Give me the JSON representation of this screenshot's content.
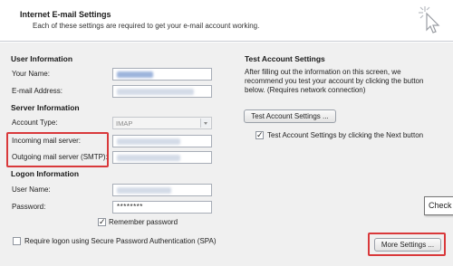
{
  "header": {
    "title": "Internet E-mail Settings",
    "subtitle": "Each of these settings are required to get your e-mail account working."
  },
  "icons": {
    "header_icon": "cursor-click-icon"
  },
  "user_info": {
    "title": "User Information",
    "your_name_label": "Your Name:",
    "email_label": "E-mail Address:"
  },
  "server_info": {
    "title": "Server Information",
    "account_type_label": "Account Type:",
    "account_type_value": "IMAP",
    "incoming_label": "Incoming mail server:",
    "outgoing_label": "Outgoing mail server (SMTP):"
  },
  "logon_info": {
    "title": "Logon Information",
    "username_label": "User Name:",
    "password_label": "Password:",
    "password_value": "********",
    "remember_label": "Remember password",
    "remember_checked": true,
    "spa_label": "Require logon using Secure Password Authentication (SPA)",
    "spa_checked": false
  },
  "test_settings": {
    "title": "Test Account Settings",
    "description": "After filling out the information on this screen, we recommend you test your account by clicking the button below. (Requires network connection)",
    "button_label": "Test Account Settings ...",
    "auto_test_label": "Test Account Settings by clicking the Next button",
    "auto_test_checked": true
  },
  "more_settings_label": "More Settings ...",
  "tooltip_text": "Check",
  "colors": {
    "highlight": "#d9393b",
    "panel": "#f0f0f0"
  }
}
